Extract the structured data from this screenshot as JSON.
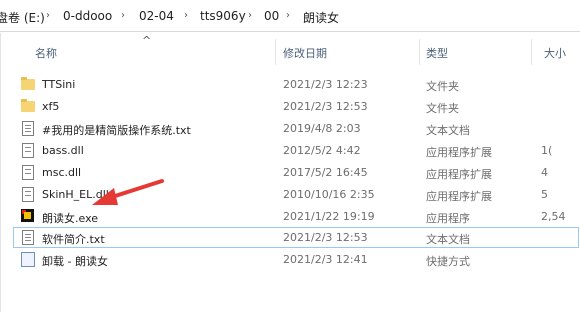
{
  "address": {
    "crumbs": [
      "盘卷 (E:)",
      "0-ddooo",
      "02-04",
      "tts906y",
      "00",
      "朗读女"
    ]
  },
  "columns": {
    "name": "名称",
    "date": "修改日期",
    "type": "类型",
    "size": "大小"
  },
  "files": [
    {
      "name": "TTSini",
      "date": "2021/2/3 12:23",
      "type": "文件夹",
      "size": "",
      "icon": "folder-icon"
    },
    {
      "name": "xf5",
      "date": "2021/2/3 12:53",
      "type": "文件夹",
      "size": "",
      "icon": "folder-icon"
    },
    {
      "name": "#我用的是精简版操作系统.txt",
      "date": "2019/4/8 2:03",
      "type": "文本文档",
      "size": "",
      "icon": "text-file-icon"
    },
    {
      "name": "bass.dll",
      "date": "2012/5/2 4:42",
      "type": "应用程序扩展",
      "size": "1(",
      "icon": "dll-file-icon"
    },
    {
      "name": "msc.dll",
      "date": "2017/5/2 16:45",
      "type": "应用程序扩展",
      "size": "4",
      "icon": "dll-file-icon"
    },
    {
      "name": "SkinH_EL.dll",
      "date": "2010/10/16 2:35",
      "type": "应用程序扩展",
      "size": "5",
      "icon": "dll-file-icon"
    },
    {
      "name": "朗读女.exe",
      "date": "2021/1/22 19:19",
      "type": "应用程序",
      "size": "2,54",
      "icon": "exe-app-icon"
    },
    {
      "name": "软件简介.txt",
      "date": "2021/2/3 12:53",
      "type": "文本文档",
      "size": "",
      "icon": "text-file-icon"
    },
    {
      "name": "卸载 - 朗读女",
      "date": "2021/2/3 12:41",
      "type": "快捷方式",
      "size": "",
      "icon": "shortcut-icon"
    }
  ],
  "colors": {
    "annotation_arrow": "#e53935",
    "header_text": "#4c607a",
    "selection_outline": "#99c8f3"
  }
}
